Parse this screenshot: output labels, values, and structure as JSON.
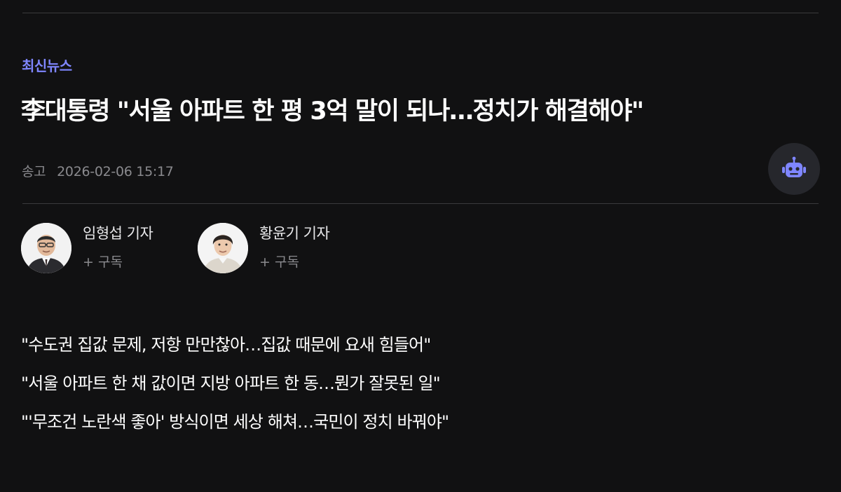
{
  "article": {
    "section": "최신뉴스",
    "headline": "李대통령 \"서울 아파트 한 평 3억 말이 되나…정치가 해결해야\"",
    "published_label": "송고",
    "published_at": "2026-02-06 15:17"
  },
  "reporters": [
    {
      "name": "임형섭 기자",
      "subscribe": "+ 구독"
    },
    {
      "name": "황윤기 기자",
      "subscribe": "+ 구독"
    }
  ],
  "summary": [
    "\"수도권 집값 문제, 저항 만만찮아…집값 때문에 요새 힘들어\"",
    "\"서울 아파트 한 채 값이면 지방 아파트 한 동…뭔가 잘못된 일\"",
    "\"'무조건 노란색 좋아' 방식이면 세상 해쳐…국민이 정치 바꿔야\""
  ],
  "icons": {
    "bot": "robot-icon",
    "avatar": "reporter-avatar"
  },
  "colors": {
    "background": "#111112",
    "accent": "#7f86ff",
    "muted": "#8a8a8e",
    "divider": "#3a3a3c",
    "bot_button_bg": "#26272c"
  }
}
